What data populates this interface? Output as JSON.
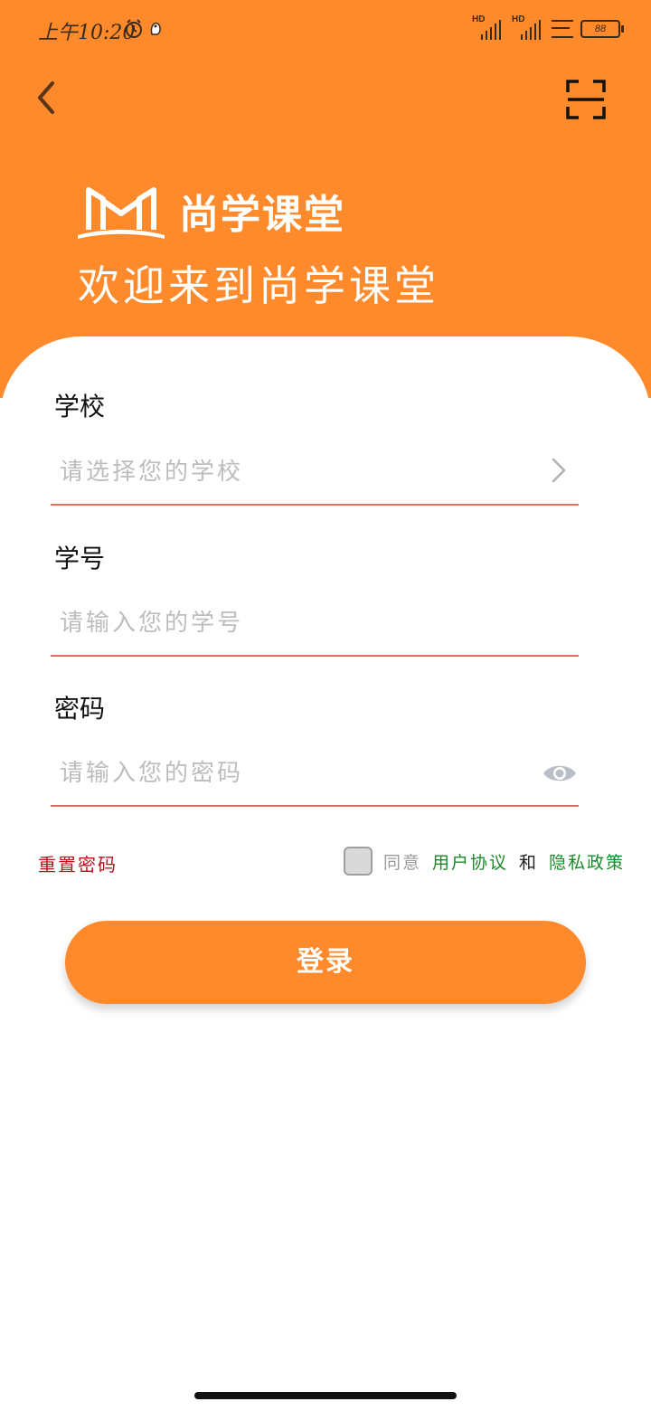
{
  "status_bar": {
    "time": "上午10:20",
    "battery": "88",
    "signal_1_label": "HD",
    "signal_2_label": "HD"
  },
  "header": {
    "back_icon": "chevron-left-icon",
    "scan_icon": "scan-icon",
    "logo_text": "尚学课堂",
    "welcome": "欢迎来到尚学课堂"
  },
  "form": {
    "school": {
      "label": "学校",
      "placeholder": "请选择您的学校"
    },
    "student_id": {
      "label": "学号",
      "placeholder": "请输入您的学号"
    },
    "password": {
      "label": "密码",
      "placeholder": "请输入您的密码"
    }
  },
  "options": {
    "reset_password": "重置密码",
    "agree": "同意",
    "user_agreement": "用户协议",
    "and": "和",
    "privacy_policy": "隐私政策",
    "checked": false
  },
  "login_button": "登录",
  "colors": {
    "accent": "#ff8a2b",
    "underline": "#e46e58",
    "reset_link": "#b8141a",
    "policy_link": "#1a8a2a"
  }
}
